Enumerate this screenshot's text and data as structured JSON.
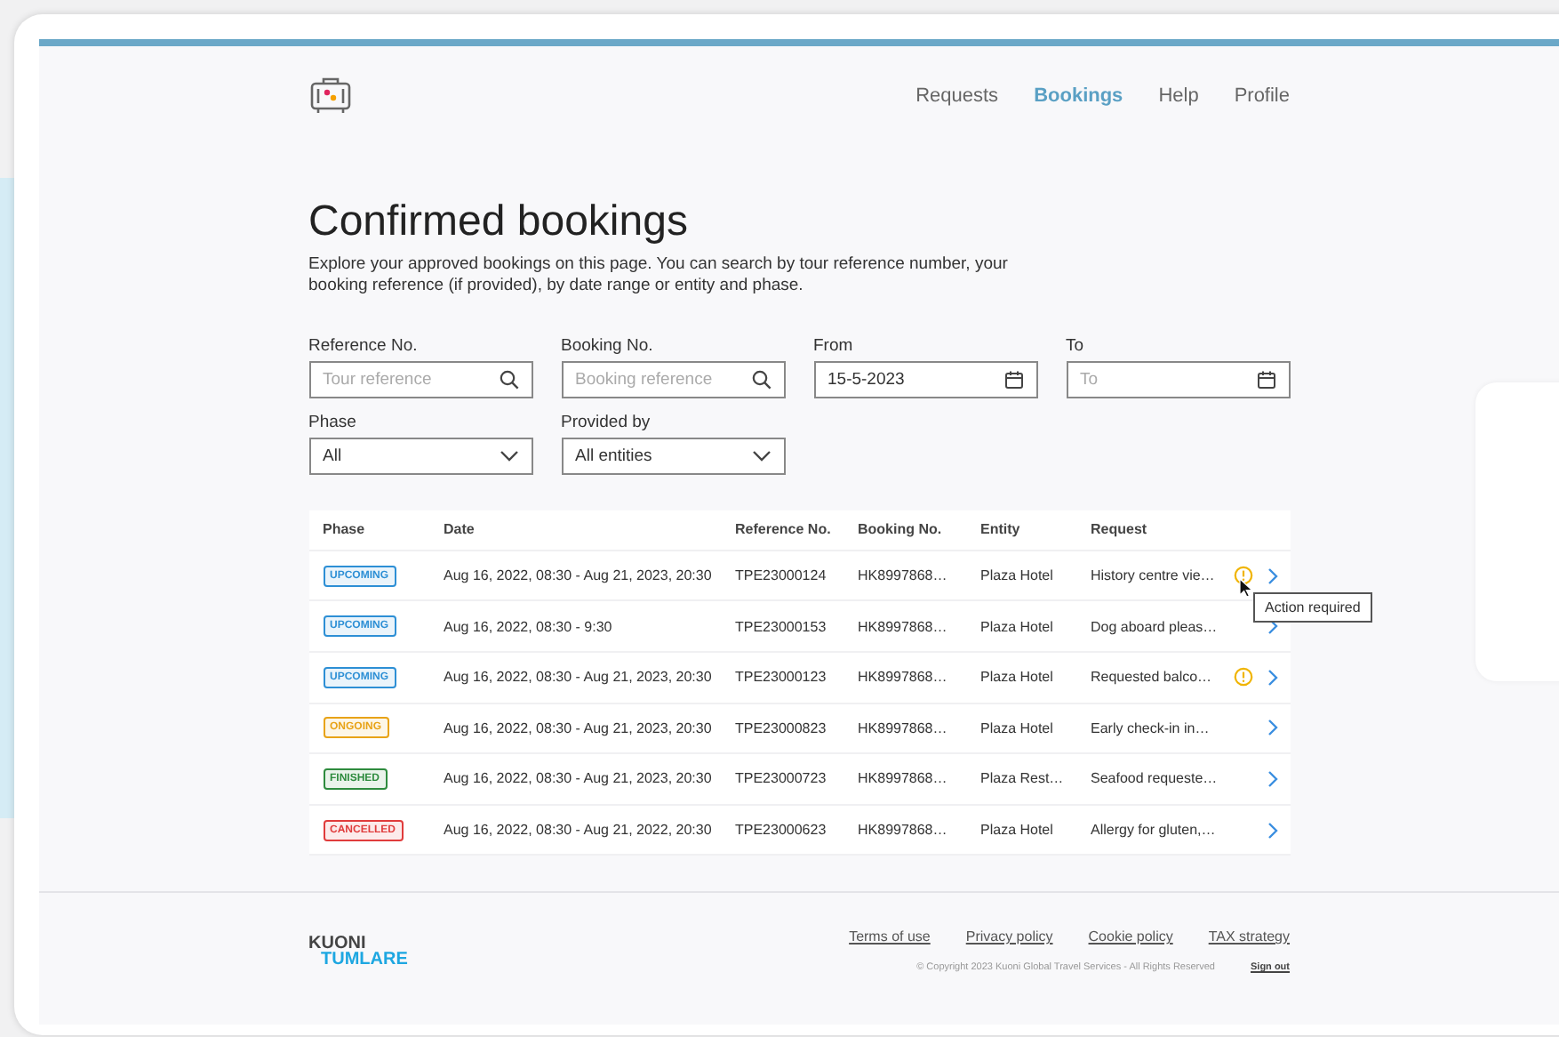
{
  "nav": [
    {
      "label": "Requests",
      "selected": false
    },
    {
      "label": "Bookings",
      "selected": true
    },
    {
      "label": "Help",
      "selected": false
    },
    {
      "label": "Profile",
      "selected": false
    }
  ],
  "title": "Confirmed bookings",
  "description": "Explore your approved bookings on this page. You can search by tour reference number, your booking reference (if provided), by date range or entity and phase.",
  "filters": [
    {
      "label": "Reference No.",
      "kind": "search",
      "placeholder": "Tour reference"
    },
    {
      "label": "Booking No.",
      "kind": "search",
      "placeholder": "Booking reference"
    },
    {
      "label": "From",
      "kind": "date",
      "value": "15-5-2023"
    },
    {
      "label": "To",
      "kind": "date",
      "placeholder": "To"
    },
    {
      "label": "Phase",
      "kind": "select",
      "value": "All"
    },
    {
      "label": "Provided by",
      "kind": "select",
      "value": "All entities"
    }
  ],
  "table": {
    "columns": [
      "Phase",
      "Date",
      "Reference No.",
      "Booking No.",
      "Entity",
      "Request"
    ],
    "rows": [
      {
        "phase": "UPCOMING",
        "color": "#2d8fd5",
        "date": "Aug 16, 2022, 08:30 - Aug 21, 2023, 20:30",
        "reference": "TPE23000124",
        "booking": "HK8997868…",
        "entity": "Plaza Hotel",
        "request": "History centre vie…",
        "alert": true,
        "tooltip": "Action required"
      },
      {
        "phase": "UPCOMING",
        "color": "#2d8fd5",
        "date": "Aug 16, 2022, 08:30 - 9:30",
        "reference": "TPE23000153",
        "booking": "HK8997868…",
        "entity": "Plaza Hotel",
        "request": "Dog aboard pleas…",
        "alert": false
      },
      {
        "phase": "UPCOMING",
        "color": "#2d8fd5",
        "date": "Aug 16, 2022, 08:30 - Aug 21, 2023, 20:30",
        "reference": "TPE23000123",
        "booking": "HK8997868…",
        "entity": "Plaza Hotel",
        "request": "Requested balco…",
        "alert": true
      },
      {
        "phase": "ONGOING",
        "color": "#e8a317",
        "date": "Aug 16, 2022, 08:30 - Aug 21, 2023, 20:30",
        "reference": "TPE23000823",
        "booking": "HK8997868…",
        "entity": "Plaza Hotel",
        "request": "Early check-in in…",
        "alert": false
      },
      {
        "phase": "FINISHED",
        "color": "#2e8b3e",
        "date": "Aug 16, 2022, 08:30 - Aug 21, 2023, 20:30",
        "reference": "TPE23000723",
        "booking": "HK8997868…",
        "entity": "Plaza Rest…",
        "request": "Seafood requeste…",
        "alert": false
      },
      {
        "phase": "CANCELLED",
        "color": "#e03c3c",
        "date": "Aug 16, 2022, 08:30 - Aug 21, 2022, 20:30",
        "reference": "TPE23000623",
        "booking": "HK8997868…",
        "entity": "Plaza Hotel",
        "request": "Allergy for gluten,…",
        "alert": false
      }
    ]
  },
  "footer": {
    "logo": [
      "KUONI",
      "TUMLARE"
    ],
    "links": [
      "Terms of use",
      "Privacy policy",
      "Cookie policy",
      "TAX strategy"
    ],
    "copyright": "© Copyright 2023 Kuoni Global Travel Services - All Rights Reserved",
    "sign_out": "Sign out"
  }
}
